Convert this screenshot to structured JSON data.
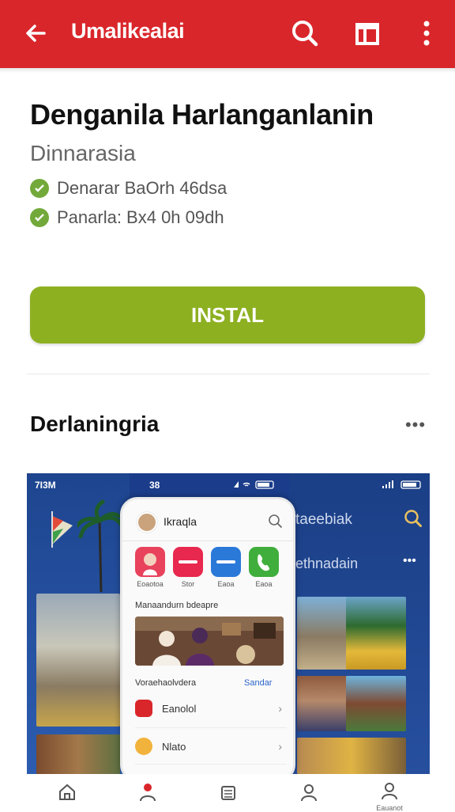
{
  "appbar": {
    "title": "Umalikealai",
    "back_icon": "arrow-back-icon",
    "search_icon": "search-icon",
    "tab_icon": "open-tab-icon",
    "more_icon": "more-vert-icon",
    "color": "#d9262b"
  },
  "app": {
    "name": "Denganila Harlanganlanin",
    "developer": "Dinnarasia",
    "features": [
      "Denarar BaOrh 46dsa",
      "Panarla: Bx4 0h 09dh"
    ]
  },
  "install": {
    "label": "INSTAL",
    "color": "#8db021"
  },
  "section": {
    "title": "Derlaningria",
    "more_label": "•••"
  },
  "screenshot": {
    "status_left": "7I3M",
    "status_mid": "38",
    "right_title": "taeebiak",
    "right_subtitle": "ethnadain",
    "right_more": "•••",
    "phone": {
      "title": "Ikraqla",
      "apps": [
        {
          "label": "Eoaotoa",
          "color": "#e8425c"
        },
        {
          "label": "Stor",
          "color": "#e8284e"
        },
        {
          "label": "Eaoa",
          "color": "#2a79d8"
        },
        {
          "label": "Eaoa",
          "color": "#3fae3c"
        }
      ],
      "section_label": "Manaandurn bdeapre",
      "recommend_label": "Voraehaolvdera",
      "recommend_link": "Sandar",
      "rows": [
        {
          "label": "Eanolol",
          "color": "#d9262b"
        },
        {
          "label": "Nlato",
          "color": "#f2b33d"
        }
      ]
    }
  },
  "bottom_nav": [
    {
      "icon": "home-icon",
      "label": ""
    },
    {
      "icon": "notifications-icon",
      "label": ""
    },
    {
      "icon": "library-icon",
      "label": ""
    },
    {
      "icon": "profile-icon",
      "label": ""
    },
    {
      "icon": "account-icon",
      "label": "Eauanot"
    }
  ]
}
